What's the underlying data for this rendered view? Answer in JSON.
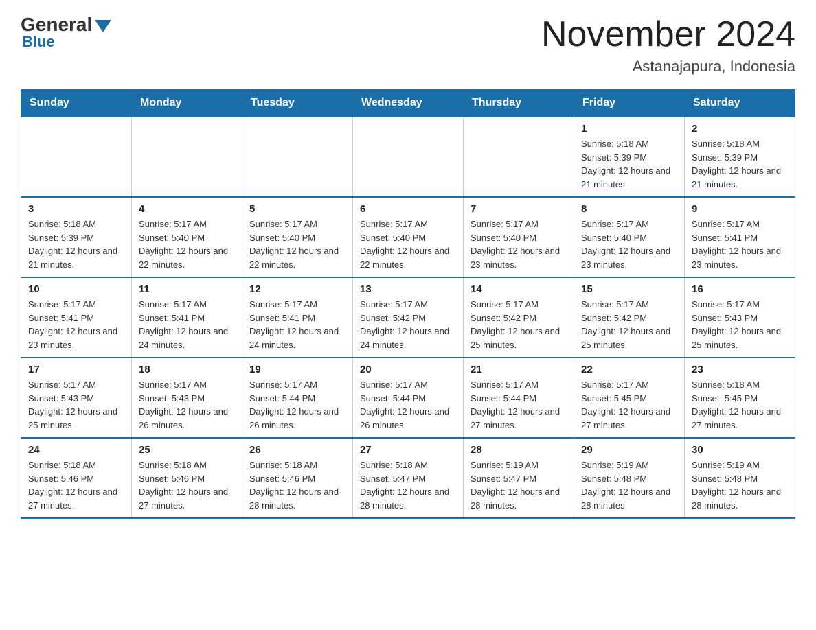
{
  "logo": {
    "general": "General",
    "blue": "Blue"
  },
  "title": "November 2024",
  "subtitle": "Astanajapura, Indonesia",
  "days_of_week": [
    "Sunday",
    "Monday",
    "Tuesday",
    "Wednesday",
    "Thursday",
    "Friday",
    "Saturday"
  ],
  "weeks": [
    [
      {
        "day": "",
        "info": ""
      },
      {
        "day": "",
        "info": ""
      },
      {
        "day": "",
        "info": ""
      },
      {
        "day": "",
        "info": ""
      },
      {
        "day": "",
        "info": ""
      },
      {
        "day": "1",
        "info": "Sunrise: 5:18 AM\nSunset: 5:39 PM\nDaylight: 12 hours and 21 minutes."
      },
      {
        "day": "2",
        "info": "Sunrise: 5:18 AM\nSunset: 5:39 PM\nDaylight: 12 hours and 21 minutes."
      }
    ],
    [
      {
        "day": "3",
        "info": "Sunrise: 5:18 AM\nSunset: 5:39 PM\nDaylight: 12 hours and 21 minutes."
      },
      {
        "day": "4",
        "info": "Sunrise: 5:17 AM\nSunset: 5:40 PM\nDaylight: 12 hours and 22 minutes."
      },
      {
        "day": "5",
        "info": "Sunrise: 5:17 AM\nSunset: 5:40 PM\nDaylight: 12 hours and 22 minutes."
      },
      {
        "day": "6",
        "info": "Sunrise: 5:17 AM\nSunset: 5:40 PM\nDaylight: 12 hours and 22 minutes."
      },
      {
        "day": "7",
        "info": "Sunrise: 5:17 AM\nSunset: 5:40 PM\nDaylight: 12 hours and 23 minutes."
      },
      {
        "day": "8",
        "info": "Sunrise: 5:17 AM\nSunset: 5:40 PM\nDaylight: 12 hours and 23 minutes."
      },
      {
        "day": "9",
        "info": "Sunrise: 5:17 AM\nSunset: 5:41 PM\nDaylight: 12 hours and 23 minutes."
      }
    ],
    [
      {
        "day": "10",
        "info": "Sunrise: 5:17 AM\nSunset: 5:41 PM\nDaylight: 12 hours and 23 minutes."
      },
      {
        "day": "11",
        "info": "Sunrise: 5:17 AM\nSunset: 5:41 PM\nDaylight: 12 hours and 24 minutes."
      },
      {
        "day": "12",
        "info": "Sunrise: 5:17 AM\nSunset: 5:41 PM\nDaylight: 12 hours and 24 minutes."
      },
      {
        "day": "13",
        "info": "Sunrise: 5:17 AM\nSunset: 5:42 PM\nDaylight: 12 hours and 24 minutes."
      },
      {
        "day": "14",
        "info": "Sunrise: 5:17 AM\nSunset: 5:42 PM\nDaylight: 12 hours and 25 minutes."
      },
      {
        "day": "15",
        "info": "Sunrise: 5:17 AM\nSunset: 5:42 PM\nDaylight: 12 hours and 25 minutes."
      },
      {
        "day": "16",
        "info": "Sunrise: 5:17 AM\nSunset: 5:43 PM\nDaylight: 12 hours and 25 minutes."
      }
    ],
    [
      {
        "day": "17",
        "info": "Sunrise: 5:17 AM\nSunset: 5:43 PM\nDaylight: 12 hours and 25 minutes."
      },
      {
        "day": "18",
        "info": "Sunrise: 5:17 AM\nSunset: 5:43 PM\nDaylight: 12 hours and 26 minutes."
      },
      {
        "day": "19",
        "info": "Sunrise: 5:17 AM\nSunset: 5:44 PM\nDaylight: 12 hours and 26 minutes."
      },
      {
        "day": "20",
        "info": "Sunrise: 5:17 AM\nSunset: 5:44 PM\nDaylight: 12 hours and 26 minutes."
      },
      {
        "day": "21",
        "info": "Sunrise: 5:17 AM\nSunset: 5:44 PM\nDaylight: 12 hours and 27 minutes."
      },
      {
        "day": "22",
        "info": "Sunrise: 5:17 AM\nSunset: 5:45 PM\nDaylight: 12 hours and 27 minutes."
      },
      {
        "day": "23",
        "info": "Sunrise: 5:18 AM\nSunset: 5:45 PM\nDaylight: 12 hours and 27 minutes."
      }
    ],
    [
      {
        "day": "24",
        "info": "Sunrise: 5:18 AM\nSunset: 5:46 PM\nDaylight: 12 hours and 27 minutes."
      },
      {
        "day": "25",
        "info": "Sunrise: 5:18 AM\nSunset: 5:46 PM\nDaylight: 12 hours and 27 minutes."
      },
      {
        "day": "26",
        "info": "Sunrise: 5:18 AM\nSunset: 5:46 PM\nDaylight: 12 hours and 28 minutes."
      },
      {
        "day": "27",
        "info": "Sunrise: 5:18 AM\nSunset: 5:47 PM\nDaylight: 12 hours and 28 minutes."
      },
      {
        "day": "28",
        "info": "Sunrise: 5:19 AM\nSunset: 5:47 PM\nDaylight: 12 hours and 28 minutes."
      },
      {
        "day": "29",
        "info": "Sunrise: 5:19 AM\nSunset: 5:48 PM\nDaylight: 12 hours and 28 minutes."
      },
      {
        "day": "30",
        "info": "Sunrise: 5:19 AM\nSunset: 5:48 PM\nDaylight: 12 hours and 28 minutes."
      }
    ]
  ]
}
